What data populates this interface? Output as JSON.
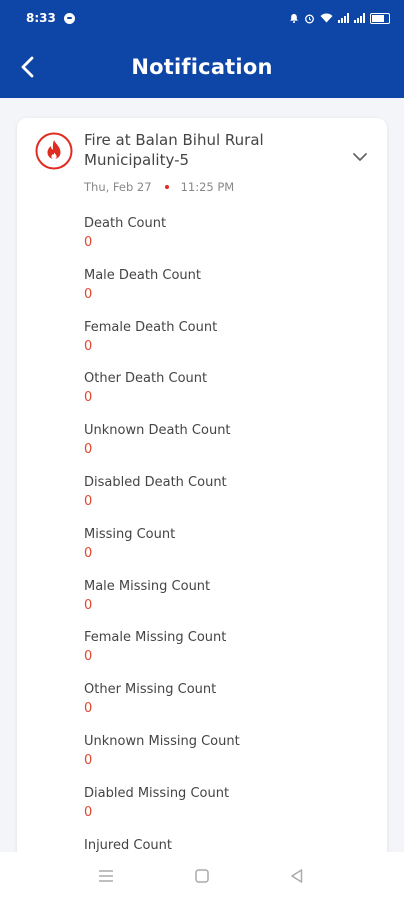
{
  "status_bar": {
    "time": "8:33"
  },
  "header": {
    "title": "Notification"
  },
  "notification": {
    "title": "Fire at Balan Bihul Rural Municipality-5",
    "date": "Thu, Feb 27",
    "time": "11:25 PM",
    "fields": [
      {
        "label": "Death Count",
        "value": "0"
      },
      {
        "label": "Male Death Count",
        "value": "0"
      },
      {
        "label": "Female Death Count",
        "value": "0"
      },
      {
        "label": "Other Death Count",
        "value": "0"
      },
      {
        "label": "Unknown Death Count",
        "value": "0"
      },
      {
        "label": "Disabled Death Count",
        "value": "0"
      },
      {
        "label": "Missing Count",
        "value": "0"
      },
      {
        "label": "Male Missing Count",
        "value": "0"
      },
      {
        "label": "Female Missing Count",
        "value": "0"
      },
      {
        "label": "Other Missing Count",
        "value": "0"
      },
      {
        "label": "Unknown Missing Count",
        "value": "0"
      },
      {
        "label": "Diabled Missing Count",
        "value": "0"
      },
      {
        "label": "Injured Count",
        "value": ""
      }
    ]
  },
  "icons": {
    "back": "back-arrow-icon",
    "fire": "fire-icon",
    "expand": "chevron-down-icon",
    "nav": [
      "menu-icon",
      "home-square-icon",
      "back-triangle-icon"
    ]
  },
  "colors": {
    "primary": "#0d46a6",
    "accent_red": "#e02b20",
    "value_red": "#e0472f"
  }
}
